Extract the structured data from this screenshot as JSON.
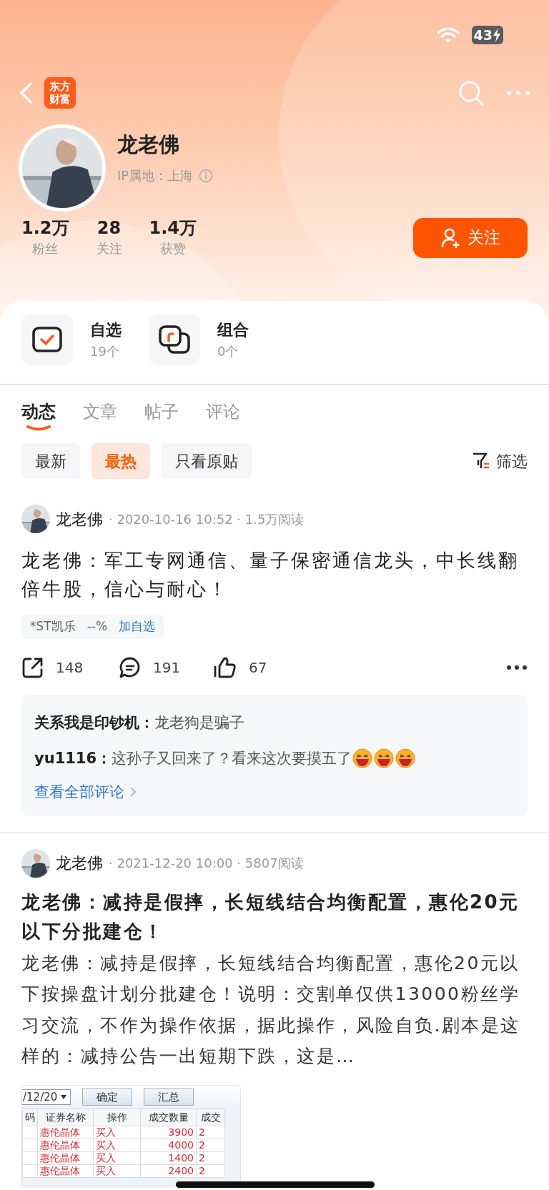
{
  "status_bar": {
    "battery": "43",
    "charging": true
  },
  "nav": {
    "logo": [
      "东方",
      "财富"
    ]
  },
  "profile": {
    "name": "龙老佛",
    "ip_location": "IP属地：上海",
    "stats": [
      {
        "value": "1.2万",
        "label": "粉丝"
      },
      {
        "value": "28",
        "label": "关注"
      },
      {
        "value": "1.4万",
        "label": "获赞"
      }
    ],
    "follow_button": "关注"
  },
  "shortcuts": [
    {
      "kind": "watchlist",
      "title": "自选",
      "count": "19个"
    },
    {
      "kind": "portfolio",
      "title": "组合",
      "count": "0个"
    }
  ],
  "tabs": [
    {
      "label": "动态",
      "selected": true
    },
    {
      "label": "文章",
      "selected": false
    },
    {
      "label": "帖子",
      "selected": false
    },
    {
      "label": "评论",
      "selected": false
    }
  ],
  "filters": [
    {
      "label": "最新",
      "selected": false
    },
    {
      "label": "最热",
      "selected": true
    },
    {
      "label": "只看原贴",
      "selected": false
    }
  ],
  "filter_button": "筛选",
  "posts": [
    {
      "kind": "status",
      "author": "龙老佛",
      "meta": "· 2020-10-16 10:52 · 1.5万阅读",
      "title": "龙老佛：军工专网通信、量子保密通信龙头，中长线翻倍牛股，信心与耐心！",
      "stock_tag": {
        "name": "*ST凯乐",
        "change": "--%",
        "action": "加自选"
      },
      "actions": {
        "shares": "148",
        "comments": "191",
        "likes": "67"
      },
      "comments": [
        {
          "text": "**关系我是印钞机：**龙老狗是骗子"
        },
        {
          "text": "**yu1116：**这孙子又回来了？看来这次要摸五了",
          "emojis": [
            {
              "kind": "laugh"
            },
            {
              "kind": "laugh"
            },
            {
              "kind": "laugh"
            }
          ]
        }
      ],
      "view_all": "查看全部评论"
    },
    {
      "kind": "article",
      "author": "龙老佛",
      "meta": "· 2021-12-20 10:00 · 5807阅读",
      "title": "龙老佛：减持是假摔，长短线结合均衡配置，惠伦20元以下分批建仓！",
      "body": "龙老佛：减持是假摔，长短线结合均衡配置，惠伦20元以下按操盘计划分批建仓！说明：交割单仅供13000粉丝学习交流，不作为操作依据，据此操作，风险自负.剧本是这样的：减持公告一出短期下跌，这是…",
      "image": {
        "kind": "screenshot",
        "date_field": "/12/20",
        "buttons": [
          "确定",
          "汇总"
        ],
        "columns": [
          "码",
          "证券名称",
          "操作",
          "成交数量",
          "成交"
        ],
        "rows": [
          {
            "name": "惠伦晶体",
            "action": "买入",
            "quantity": "3900",
            "column_5": "2"
          },
          {
            "name": "惠伦晶体",
            "action": "买入",
            "quantity": "4000",
            "column_5": "2"
          },
          {
            "name": "惠伦晶体",
            "action": "买入",
            "quantity": "1400",
            "column_5": "2"
          },
          {
            "name": "惠伦晶体",
            "action": "买入",
            "quantity": "2400",
            "column_5": "2"
          }
        ]
      }
    }
  ]
}
